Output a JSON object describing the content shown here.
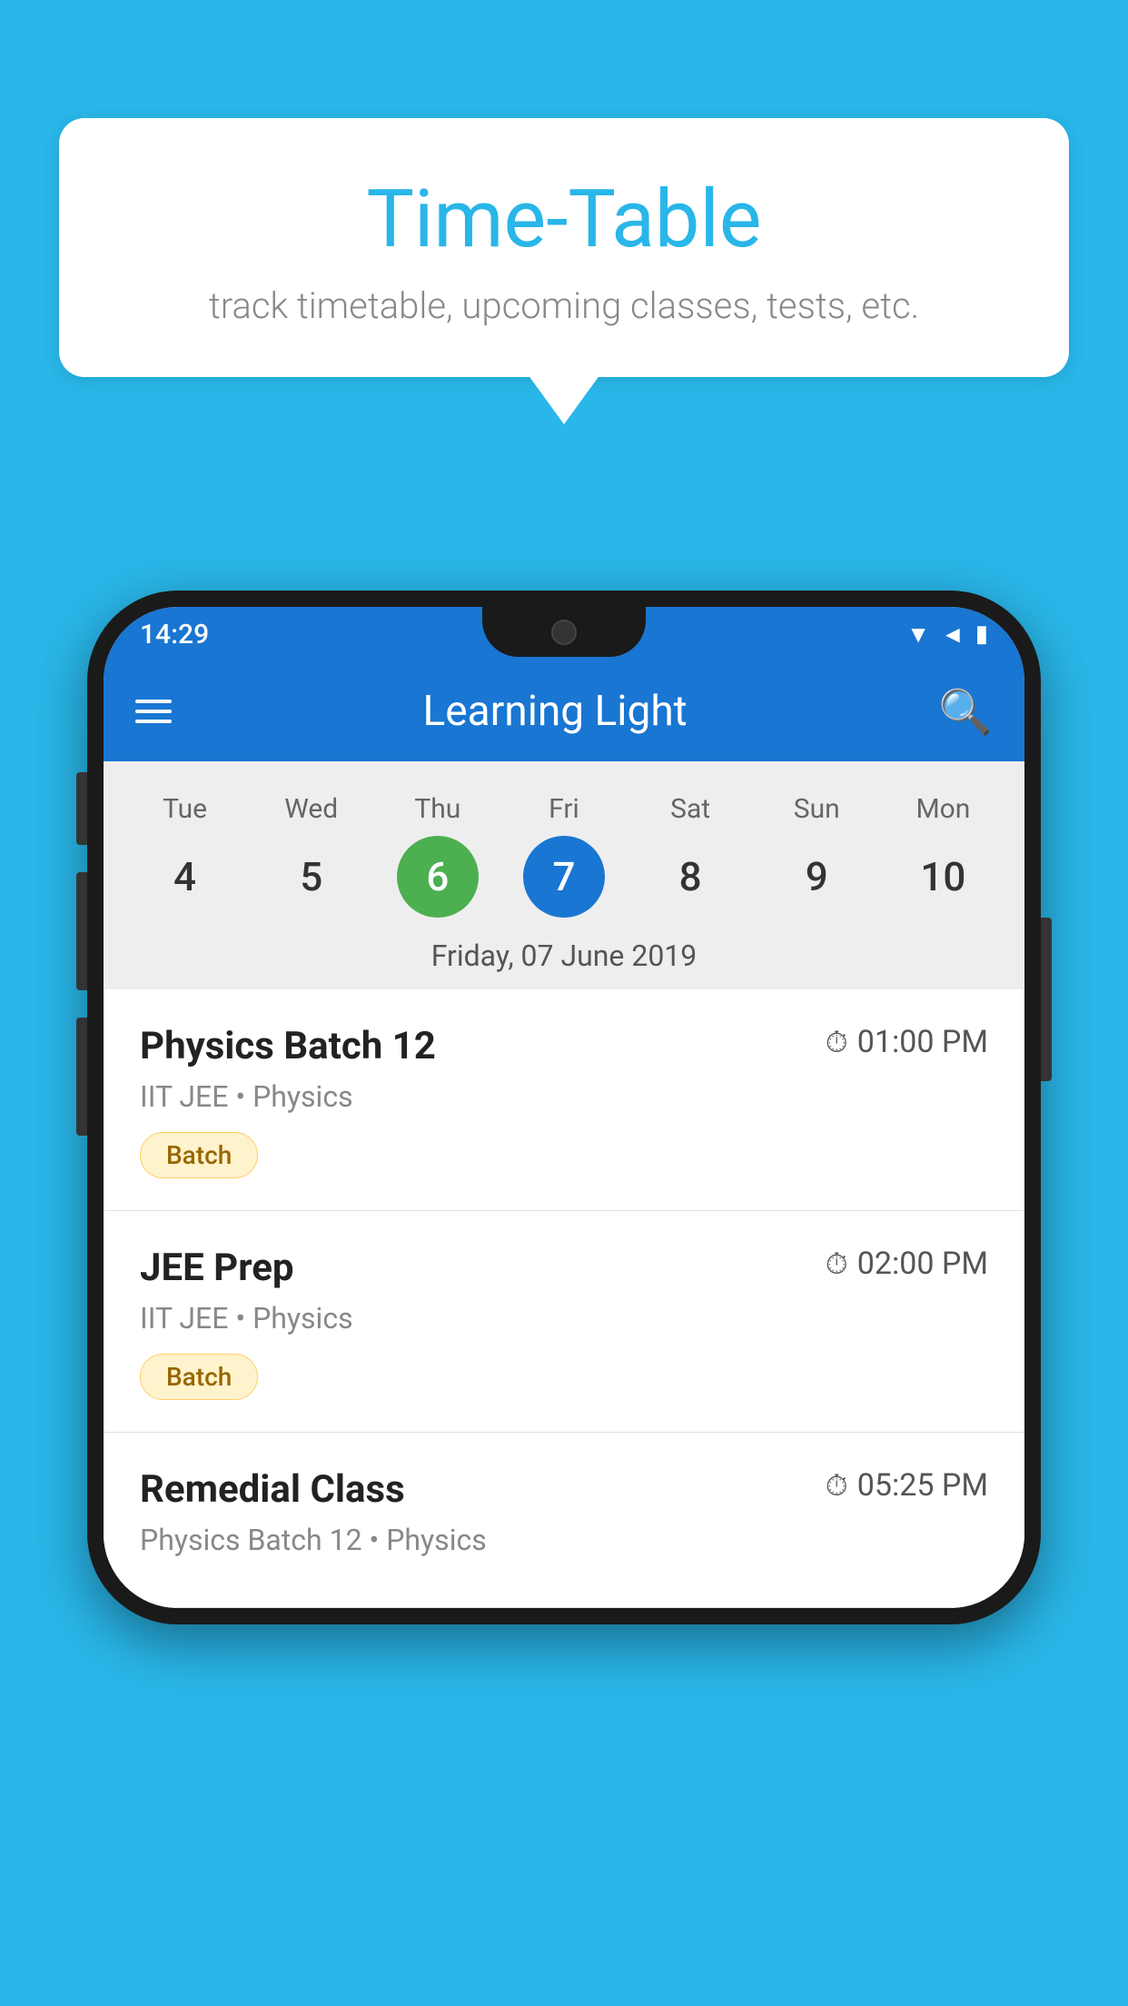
{
  "background_color": "#29B6E8",
  "bubble": {
    "title": "Time-Table",
    "subtitle": "track timetable, upcoming classes, tests, etc."
  },
  "phone": {
    "status_bar": {
      "time": "14:29"
    },
    "app_bar": {
      "title": "Learning Light"
    },
    "calendar": {
      "days": [
        {
          "name": "Tue",
          "number": "4",
          "state": "normal"
        },
        {
          "name": "Wed",
          "number": "5",
          "state": "normal"
        },
        {
          "name": "Thu",
          "number": "6",
          "state": "today"
        },
        {
          "name": "Fri",
          "number": "7",
          "state": "selected"
        },
        {
          "name": "Sat",
          "number": "8",
          "state": "normal"
        },
        {
          "name": "Sun",
          "number": "9",
          "state": "normal"
        },
        {
          "name": "Mon",
          "number": "10",
          "state": "normal"
        }
      ],
      "selected_date": "Friday, 07 June 2019"
    },
    "classes": [
      {
        "name": "Physics Batch 12",
        "time": "01:00 PM",
        "info": "IIT JEE • Physics",
        "badge": "Batch"
      },
      {
        "name": "JEE Prep",
        "time": "02:00 PM",
        "info": "IIT JEE • Physics",
        "badge": "Batch"
      },
      {
        "name": "Remedial Class",
        "time": "05:25 PM",
        "info": "Physics Batch 12 • Physics",
        "badge": null
      }
    ]
  }
}
